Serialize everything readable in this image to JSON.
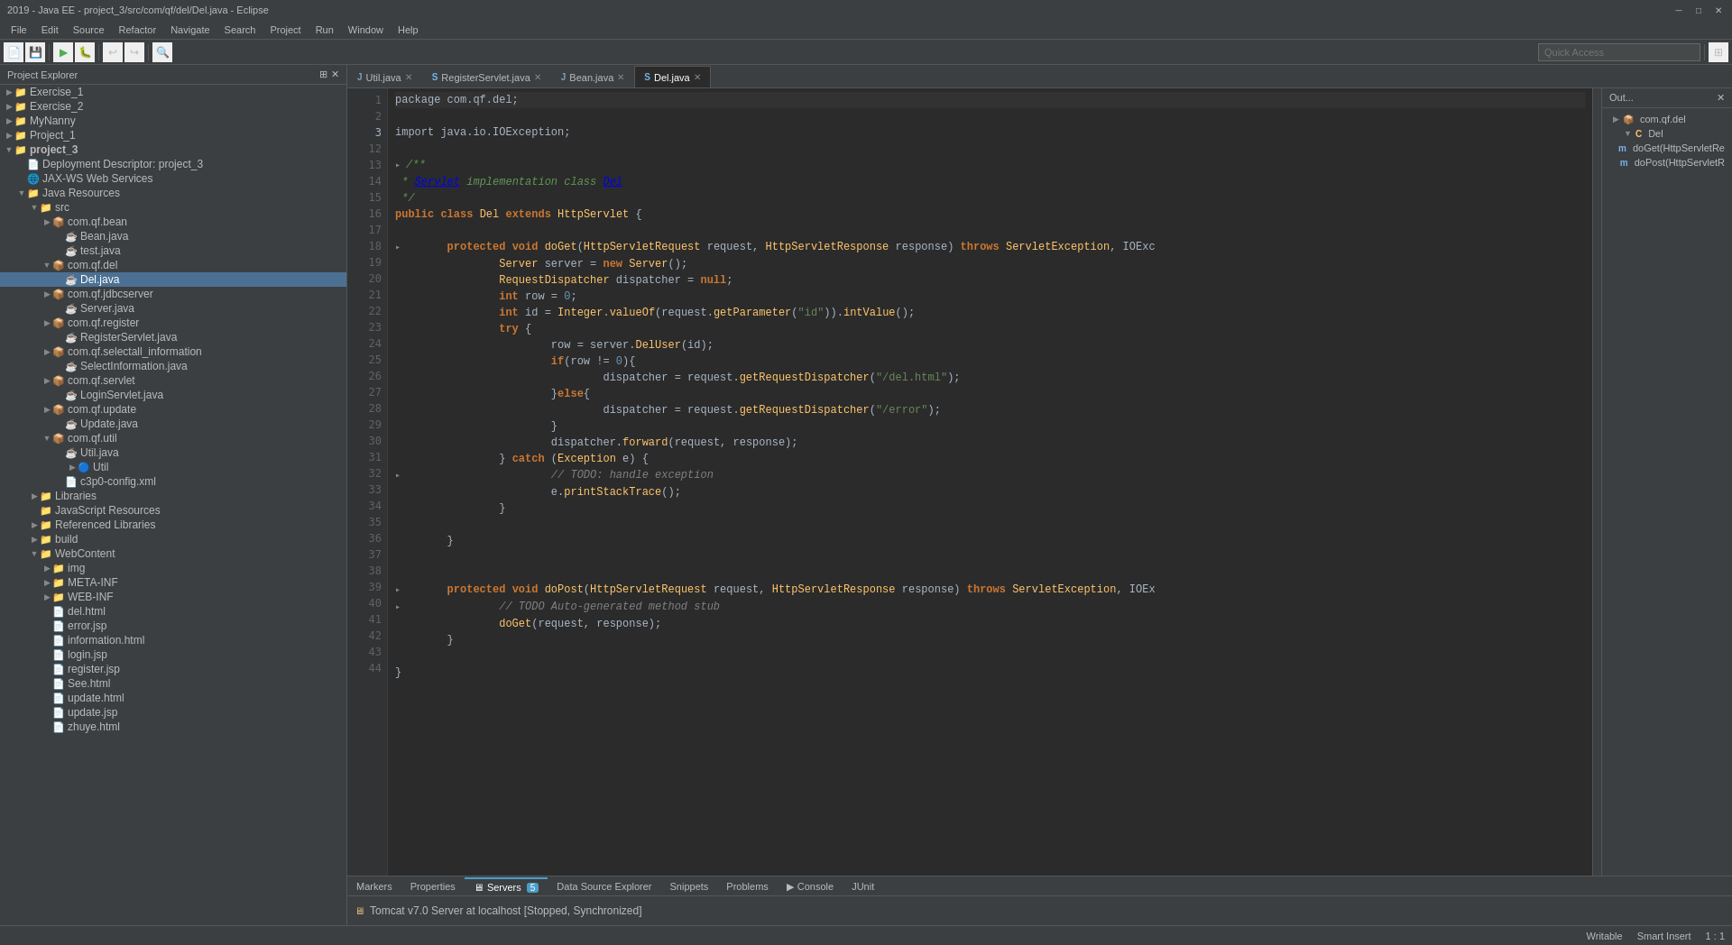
{
  "titlebar": {
    "title": "2019 - Java EE - project_3/src/com/qf/del/Del.java - Eclipse",
    "minimize": "─",
    "maximize": "□",
    "close": "✕"
  },
  "menubar": {
    "items": [
      "File",
      "Edit",
      "Source",
      "Refactor",
      "Navigate",
      "Search",
      "Project",
      "Run",
      "Window",
      "Help"
    ]
  },
  "tabs": [
    {
      "label": "Util.java",
      "icon": "J",
      "active": false
    },
    {
      "label": "RegisterServlet.java",
      "icon": "S",
      "active": false
    },
    {
      "label": "Bean.java",
      "icon": "J",
      "active": false
    },
    {
      "label": "Del.java",
      "icon": "S",
      "active": true
    }
  ],
  "sidebar": {
    "title": "Project Explorer",
    "tree": [
      {
        "indent": 0,
        "arrow": "▶",
        "icon": "📁",
        "label": "Exercise_1"
      },
      {
        "indent": 0,
        "arrow": "▶",
        "icon": "📁",
        "label": "Exercise_2"
      },
      {
        "indent": 0,
        "arrow": "▶",
        "icon": "📁",
        "label": "MyNanny"
      },
      {
        "indent": 0,
        "arrow": "▶",
        "icon": "📁",
        "label": "Project_1"
      },
      {
        "indent": 0,
        "arrow": "▼",
        "icon": "📁",
        "label": "project_3",
        "bold": true
      },
      {
        "indent": 1,
        "arrow": " ",
        "icon": "📄",
        "label": "Deployment Descriptor: project_3"
      },
      {
        "indent": 1,
        "arrow": " ",
        "icon": "🌐",
        "label": "JAX-WS Web Services"
      },
      {
        "indent": 1,
        "arrow": "▼",
        "icon": "📁",
        "label": "Java Resources"
      },
      {
        "indent": 2,
        "arrow": "▼",
        "icon": "📁",
        "label": "src"
      },
      {
        "indent": 3,
        "arrow": "▶",
        "icon": "📦",
        "label": "com.qf.bean"
      },
      {
        "indent": 4,
        "arrow": " ",
        "icon": "☕",
        "label": "Bean.java"
      },
      {
        "indent": 4,
        "arrow": " ",
        "icon": "☕",
        "label": "test.java"
      },
      {
        "indent": 3,
        "arrow": "▼",
        "icon": "📦",
        "label": "com.qf.del"
      },
      {
        "indent": 4,
        "arrow": " ",
        "icon": "☕",
        "label": "Del.java",
        "selected": true
      },
      {
        "indent": 3,
        "arrow": "▶",
        "icon": "📦",
        "label": "com.qf.jdbcserver"
      },
      {
        "indent": 4,
        "arrow": " ",
        "icon": "☕",
        "label": "Server.java"
      },
      {
        "indent": 3,
        "arrow": "▶",
        "icon": "📦",
        "label": "com.qf.register"
      },
      {
        "indent": 4,
        "arrow": " ",
        "icon": "☕",
        "label": "RegisterServlet.java"
      },
      {
        "indent": 3,
        "arrow": "▶",
        "icon": "📦",
        "label": "com.qf.selectall_information"
      },
      {
        "indent": 4,
        "arrow": " ",
        "icon": "☕",
        "label": "SelectInformation.java"
      },
      {
        "indent": 3,
        "arrow": "▶",
        "icon": "📦",
        "label": "com.qf.servlet"
      },
      {
        "indent": 4,
        "arrow": " ",
        "icon": "☕",
        "label": "LoginServlet.java"
      },
      {
        "indent": 3,
        "arrow": "▶",
        "icon": "📦",
        "label": "com.qf.update"
      },
      {
        "indent": 4,
        "arrow": " ",
        "icon": "☕",
        "label": "Update.java"
      },
      {
        "indent": 3,
        "arrow": "▼",
        "icon": "📦",
        "label": "com.qf.util"
      },
      {
        "indent": 4,
        "arrow": " ",
        "icon": "☕",
        "label": "Util.java"
      },
      {
        "indent": 5,
        "arrow": "▶",
        "icon": "🔵",
        "label": "Util"
      },
      {
        "indent": 4,
        "arrow": " ",
        "icon": "📄",
        "label": "c3p0-config.xml"
      },
      {
        "indent": 2,
        "arrow": "▶",
        "icon": "📁",
        "label": "Libraries"
      },
      {
        "indent": 2,
        "arrow": " ",
        "icon": "📁",
        "label": "JavaScript Resources"
      },
      {
        "indent": 2,
        "arrow": "▶",
        "icon": "📁",
        "label": "Referenced Libraries"
      },
      {
        "indent": 2,
        "arrow": "▶",
        "icon": "📁",
        "label": "build"
      },
      {
        "indent": 2,
        "arrow": "▼",
        "icon": "📁",
        "label": "WebContent"
      },
      {
        "indent": 3,
        "arrow": "▶",
        "icon": "📁",
        "label": "img"
      },
      {
        "indent": 3,
        "arrow": "▶",
        "icon": "📁",
        "label": "META-INF"
      },
      {
        "indent": 3,
        "arrow": "▶",
        "icon": "📁",
        "label": "WEB-INF"
      },
      {
        "indent": 3,
        "arrow": " ",
        "icon": "📄",
        "label": "del.html"
      },
      {
        "indent": 3,
        "arrow": " ",
        "icon": "📄",
        "label": "error.jsp"
      },
      {
        "indent": 3,
        "arrow": " ",
        "icon": "📄",
        "label": "information.html"
      },
      {
        "indent": 3,
        "arrow": " ",
        "icon": "📄",
        "label": "login.jsp"
      },
      {
        "indent": 3,
        "arrow": " ",
        "icon": "📄",
        "label": "register.jsp"
      },
      {
        "indent": 3,
        "arrow": " ",
        "icon": "📄",
        "label": "See.html"
      },
      {
        "indent": 3,
        "arrow": " ",
        "icon": "📄",
        "label": "update.html"
      },
      {
        "indent": 3,
        "arrow": " ",
        "icon": "📄",
        "label": "update.jsp"
      },
      {
        "indent": 3,
        "arrow": " ",
        "icon": "📄",
        "label": "zhuye.html"
      }
    ]
  },
  "code_lines": [
    {
      "num": "1",
      "content": "package com.qf.del;",
      "type": "normal"
    },
    {
      "num": "2",
      "content": "",
      "type": "normal"
    },
    {
      "num": "3",
      "content": "import java.io.IOException;",
      "type": "normal"
    },
    {
      "num": "12",
      "content": "",
      "type": "normal"
    },
    {
      "num": "13",
      "content": "/**",
      "type": "javadoc"
    },
    {
      "num": "14",
      "content": " * Servlet implementation class Del",
      "type": "javadoc"
    },
    {
      "num": "15",
      "content": " */",
      "type": "javadoc"
    },
    {
      "num": "16",
      "content": "public class Del extends HttpServlet {",
      "type": "normal"
    },
    {
      "num": "17",
      "content": "",
      "type": "normal"
    },
    {
      "num": "18",
      "content": "\tprotected void doGet(HttpServletRequest request, HttpServletResponse response) throws ServletException, IOExc",
      "type": "normal",
      "fold": true
    },
    {
      "num": "19",
      "content": "\t\tServer server = new Server();",
      "type": "normal"
    },
    {
      "num": "20",
      "content": "\t\tRequestDispatcher dispatcher = null;",
      "type": "normal"
    },
    {
      "num": "21",
      "content": "\t\tint row = 0;",
      "type": "normal"
    },
    {
      "num": "22",
      "content": "\t\tint id = Integer.valueOf(request.getParameter(\"id\")).intValue();",
      "type": "normal"
    },
    {
      "num": "23",
      "content": "\t\ttry {",
      "type": "normal"
    },
    {
      "num": "24",
      "content": "\t\t\trow = server.DelUser(id);",
      "type": "normal"
    },
    {
      "num": "25",
      "content": "\t\t\tif(row != 0){",
      "type": "normal"
    },
    {
      "num": "26",
      "content": "\t\t\t\tdispatcher = request.getRequestDispatcher(\"/del.html\");",
      "type": "normal"
    },
    {
      "num": "27",
      "content": "\t\t\t}else{",
      "type": "normal"
    },
    {
      "num": "28",
      "content": "\t\t\t\tdispatcher = request.getRequestDispatcher(\"/error\");",
      "type": "normal"
    },
    {
      "num": "29",
      "content": "\t\t\t}",
      "type": "normal"
    },
    {
      "num": "30",
      "content": "\t\t\tdispatcher.forward(request, response);",
      "type": "normal"
    },
    {
      "num": "31",
      "content": "\t\t} catch (Exception e) {",
      "type": "normal"
    },
    {
      "num": "32",
      "content": "\t\t\t// TODO: handle exception",
      "type": "comment",
      "fold": true
    },
    {
      "num": "33",
      "content": "\t\t\te.printStackTrace();",
      "type": "normal"
    },
    {
      "num": "34",
      "content": "\t\t}",
      "type": "normal"
    },
    {
      "num": "35",
      "content": "",
      "type": "normal"
    },
    {
      "num": "36",
      "content": "\t}",
      "type": "normal"
    },
    {
      "num": "37",
      "content": "",
      "type": "normal"
    },
    {
      "num": "38",
      "content": "",
      "type": "normal"
    },
    {
      "num": "39",
      "content": "\tprotected void doPost(HttpServletRequest request, HttpServletResponse response) throws ServletException, IOEx",
      "type": "normal",
      "fold": true
    },
    {
      "num": "40",
      "content": "\t\t// TODO Auto-generated method stub",
      "type": "comment",
      "fold": true
    },
    {
      "num": "41",
      "content": "\t\tdoGet(request, response);",
      "type": "normal"
    },
    {
      "num": "42",
      "content": "\t}",
      "type": "normal"
    },
    {
      "num": "43",
      "content": "",
      "type": "normal"
    },
    {
      "num": "44",
      "content": "}",
      "type": "normal"
    }
  ],
  "outline": {
    "title": "Out...",
    "items": [
      {
        "indent": 0,
        "arrow": "▶",
        "icon": "C",
        "label": "com.qf.del"
      },
      {
        "indent": 1,
        "arrow": "▼",
        "icon": "C",
        "label": "Del"
      },
      {
        "indent": 2,
        "arrow": " ",
        "icon": "m",
        "label": "doGet(HttpServletRe"
      },
      {
        "indent": 2,
        "arrow": " ",
        "icon": "m",
        "label": "doPost(HttpServletR"
      }
    ]
  },
  "bottom_tabs": [
    "Markers",
    "Properties",
    "Servers",
    "Data Source Explorer",
    "Snippets",
    "Problems",
    "Console",
    "JUnit"
  ],
  "active_bottom_tab": "Servers",
  "server_row": {
    "icon": "▶",
    "label": "Tomcat v7.0 Server at localhost  [Stopped, Synchronized]"
  },
  "bottom_tab_badge": "5",
  "status": {
    "writable": "Writable",
    "insert": "Smart Insert",
    "position": "1 : 1"
  },
  "toolbar_search_placeholder": "Quick Access"
}
